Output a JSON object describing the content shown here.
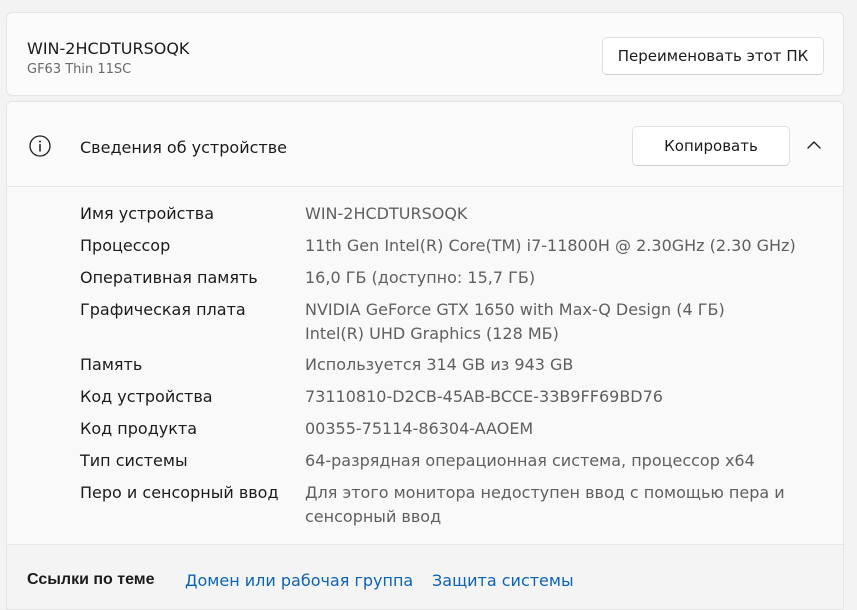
{
  "pc": {
    "name": "WIN-2HCDTURSOQK",
    "model": "GF63 Thin 11SC",
    "rename_label": "Переименовать этот ПК"
  },
  "device_specs": {
    "title": "Сведения об устройстве",
    "copy_label": "Копировать",
    "rows": [
      {
        "label": "Имя устройства",
        "value": [
          "WIN-2HCDTURSOQK"
        ]
      },
      {
        "label": "Процессор",
        "value": [
          "11th Gen Intel(R) Core(TM) i7-11800H @ 2.30GHz (2.30 GHz)"
        ]
      },
      {
        "label": "Оперативная память",
        "value": [
          "16,0 ГБ (доступно: 15,7 ГБ)"
        ]
      },
      {
        "label": "Графическая плата",
        "value": [
          "NVIDIA GeForce GTX 1650 with Max-Q Design (4 ГБ)",
          "Intel(R) UHD Graphics (128 МБ)"
        ]
      },
      {
        "label": "Память",
        "value": [
          "Используется 314 GB из 943 GB"
        ]
      },
      {
        "label": "Код устройства",
        "value": [
          "73110810-D2CB-45AB-BCCE-33B9FF69BD76"
        ]
      },
      {
        "label": "Код продукта",
        "value": [
          "00355-75114-86304-AAOEM"
        ]
      },
      {
        "label": "Тип системы",
        "value": [
          "64-разрядная операционная система, процессор x64"
        ]
      },
      {
        "label": "Перо и сенсорный ввод",
        "value": [
          "Для этого монитора недоступен ввод с помощью пера и",
          "сенсорный ввод"
        ]
      }
    ]
  },
  "related": {
    "title": "Ссылки по теме",
    "links": [
      "Домен или рабочая группа",
      "Защита системы"
    ]
  },
  "colors": {
    "link": "#0b63b5",
    "value_text": "#5f5f5f"
  },
  "icons": {
    "info": "info-circle-icon",
    "chevron": "chevron-up-icon"
  }
}
